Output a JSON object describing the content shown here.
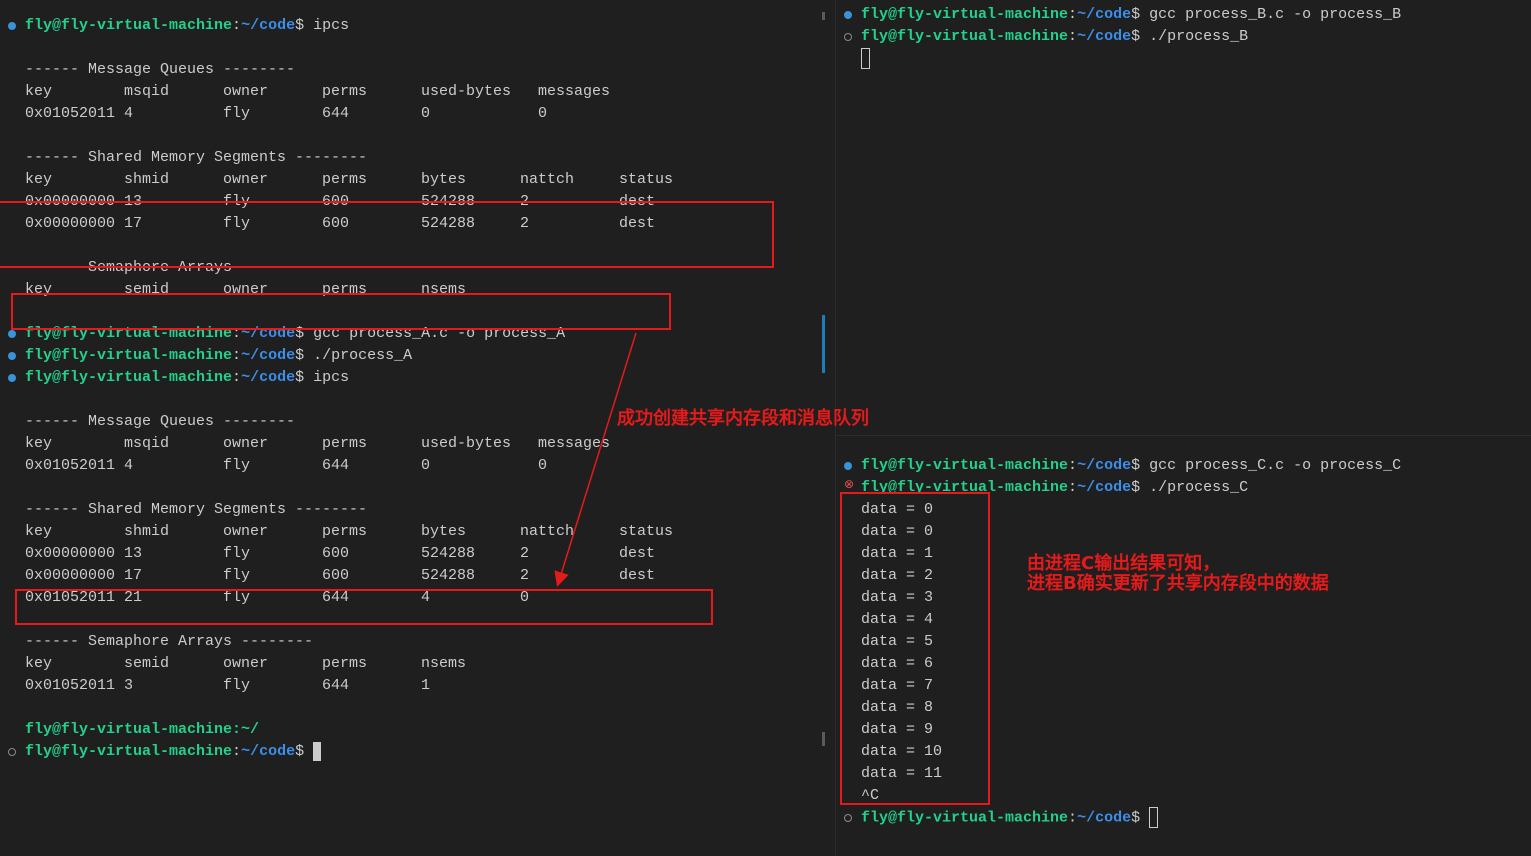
{
  "colors": {
    "user": "#23d18b",
    "path": "#3b8eea",
    "annotation": "#e51a1a",
    "background": "#1f1f1f"
  },
  "prompt": {
    "user_host": "fly@fly-virtual-machine",
    "sep": ":",
    "cwd": "~/code",
    "dollar": "$"
  },
  "left": {
    "lines": [
      {
        "t": "prompt",
        "status": "ok",
        "cmd": " ipcs"
      },
      {
        "t": "blank"
      },
      {
        "t": "text",
        "text": "------ Message Queues --------"
      },
      {
        "t": "row",
        "w": [
          11,
          11,
          11,
          11,
          13
        ],
        "cells": [
          "key",
          "msqid",
          "owner",
          "perms",
          "used-bytes",
          "messages"
        ]
      },
      {
        "t": "row",
        "w": [
          11,
          11,
          11,
          11,
          13
        ],
        "cells": [
          "0x01052011",
          "4",
          "fly",
          "644",
          "0",
          "0"
        ]
      },
      {
        "t": "blank"
      },
      {
        "t": "text",
        "text": "------ Shared Memory Segments --------"
      },
      {
        "t": "row",
        "w": [
          11,
          11,
          11,
          11,
          11,
          11
        ],
        "cells": [
          "key",
          "shmid",
          "owner",
          "perms",
          "bytes",
          "nattch",
          "status"
        ]
      },
      {
        "t": "row",
        "w": [
          11,
          11,
          11,
          11,
          11,
          11
        ],
        "cells": [
          "0x00000000",
          "13",
          "fly",
          "600",
          "524288",
          "2",
          "dest"
        ]
      },
      {
        "t": "row",
        "w": [
          11,
          11,
          11,
          11,
          11,
          11
        ],
        "cells": [
          "0x00000000",
          "17",
          "fly",
          "600",
          "524288",
          "2",
          "dest"
        ]
      },
      {
        "t": "blank"
      },
      {
        "t": "text",
        "text": "------ Semaphore Arrays --------"
      },
      {
        "t": "row",
        "w": [
          11,
          11,
          11,
          11
        ],
        "cells": [
          "key",
          "semid",
          "owner",
          "perms",
          "nsems"
        ]
      },
      {
        "t": "blank"
      },
      {
        "t": "prompt",
        "status": "ok",
        "cmd": " gcc process_A.c -o process_A"
      },
      {
        "t": "prompt",
        "status": "ok",
        "cmd": " ./process_A"
      },
      {
        "t": "prompt",
        "status": "ok",
        "cmd": " ipcs"
      },
      {
        "t": "blank"
      },
      {
        "t": "text",
        "text": "------ Message Queues --------"
      },
      {
        "t": "row",
        "w": [
          11,
          11,
          11,
          11,
          13
        ],
        "cells": [
          "key",
          "msqid",
          "owner",
          "perms",
          "used-bytes",
          "messages"
        ]
      },
      {
        "t": "row",
        "w": [
          11,
          11,
          11,
          11,
          13
        ],
        "cells": [
          "0x01052011",
          "4",
          "fly",
          "644",
          "0",
          "0"
        ]
      },
      {
        "t": "blank"
      },
      {
        "t": "text",
        "text": "------ Shared Memory Segments --------"
      },
      {
        "t": "row",
        "w": [
          11,
          11,
          11,
          11,
          11,
          11
        ],
        "cells": [
          "key",
          "shmid",
          "owner",
          "perms",
          "bytes",
          "nattch",
          "status"
        ]
      },
      {
        "t": "row",
        "w": [
          11,
          11,
          11,
          11,
          11,
          11
        ],
        "cells": [
          "0x00000000",
          "13",
          "fly",
          "600",
          "524288",
          "2",
          "dest"
        ]
      },
      {
        "t": "row",
        "w": [
          11,
          11,
          11,
          11,
          11,
          11
        ],
        "cells": [
          "0x00000000",
          "17",
          "fly",
          "600",
          "524288",
          "2",
          "dest"
        ]
      },
      {
        "t": "row",
        "w": [
          11,
          11,
          11,
          11,
          11,
          11
        ],
        "cells": [
          "0x01052011",
          "21",
          "fly",
          "644",
          "4",
          "0"
        ]
      },
      {
        "t": "blank"
      },
      {
        "t": "text",
        "text": "------ Semaphore Arrays --------"
      },
      {
        "t": "row",
        "w": [
          11,
          11,
          11,
          11
        ],
        "cells": [
          "key",
          "semid",
          "owner",
          "perms",
          "nsems"
        ]
      },
      {
        "t": "row",
        "w": [
          11,
          11,
          11,
          11
        ],
        "cells": [
          "0x01052011",
          "3",
          "fly",
          "644",
          "1"
        ]
      },
      {
        "t": "blank"
      },
      {
        "t": "partial",
        "text": "fly@fly-virtual-machine:~/"
      },
      {
        "t": "prompt",
        "status": "idle",
        "cmd": " ",
        "cursor": "solid"
      }
    ]
  },
  "right_top": {
    "lines": [
      {
        "t": "prompt",
        "status": "ok",
        "cmd": " gcc process_B.c -o process_B"
      },
      {
        "t": "prompt",
        "status": "idle",
        "cmd": " ./process_B"
      },
      {
        "t": "cursor"
      }
    ]
  },
  "right_bottom": {
    "lines": [
      {
        "t": "prompt",
        "status": "ok",
        "cmd": " gcc process_C.c -o process_C"
      },
      {
        "t": "prompt",
        "status": "err",
        "cmd": " ./process_C"
      },
      {
        "t": "text",
        "text": "data = 0"
      },
      {
        "t": "text",
        "text": "data = 0"
      },
      {
        "t": "text",
        "text": "data = 1"
      },
      {
        "t": "text",
        "text": "data = 2"
      },
      {
        "t": "text",
        "text": "data = 3"
      },
      {
        "t": "text",
        "text": "data = 4"
      },
      {
        "t": "text",
        "text": "data = 5"
      },
      {
        "t": "text",
        "text": "data = 6"
      },
      {
        "t": "text",
        "text": "data = 7"
      },
      {
        "t": "text",
        "text": "data = 8"
      },
      {
        "t": "text",
        "text": "data = 9"
      },
      {
        "t": "text",
        "text": "data = 10"
      },
      {
        "t": "text",
        "text": "data = 11"
      },
      {
        "t": "text",
        "text": "^C"
      },
      {
        "t": "prompt",
        "status": "idle",
        "cmd": " ",
        "cursor": "hollow"
      }
    ]
  },
  "annotations": {
    "left_note": "成功创建共享内存段和消息队列",
    "right_note": "由进程C输出结果可知，\n进程B确实更新了共享内存段中的数据"
  }
}
